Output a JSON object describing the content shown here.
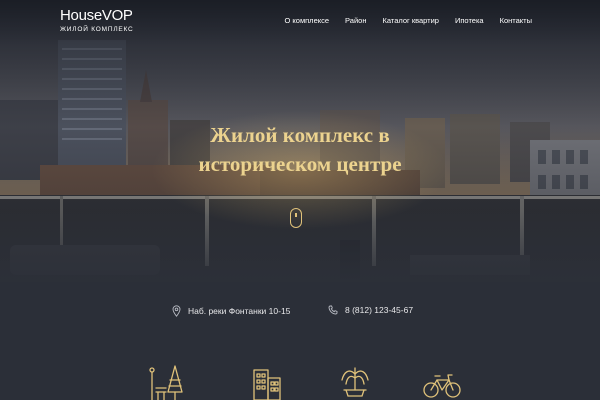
{
  "header": {
    "logo": "HouseVOP",
    "tagline": "ЖИЛОЙ КОМПЛЕКС",
    "nav": [
      {
        "label": "О комплексе"
      },
      {
        "label": "Район"
      },
      {
        "label": "Каталог квартир"
      },
      {
        "label": "Ипотека"
      },
      {
        "label": "Контакты"
      }
    ]
  },
  "hero": {
    "title_line1": "Жилой комплекс в",
    "title_line2": "историческом центре"
  },
  "contacts": {
    "address": "Наб. реки Фонтанки 10-15",
    "phone": "8 (812) 123-45-67"
  },
  "features": [
    {
      "icon": "park-icon"
    },
    {
      "icon": "buildings-icon"
    },
    {
      "icon": "fountain-icon"
    },
    {
      "icon": "bicycle-icon"
    }
  ],
  "colors": {
    "background": "#2b2f38",
    "accent_gold": "#ecd38f",
    "icon_gold": "#e0c27a"
  }
}
